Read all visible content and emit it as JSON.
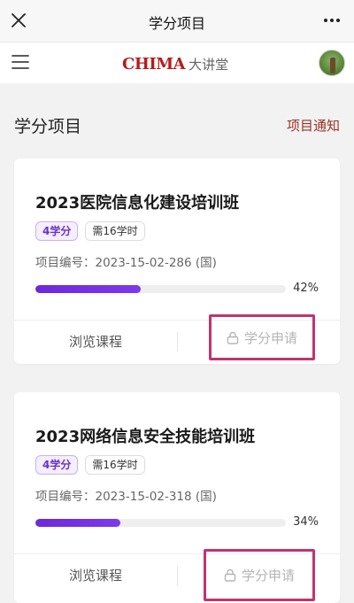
{
  "window": {
    "title": "学分项目"
  },
  "navbar": {
    "logo_brand": "CHIMA",
    "logo_sub": "大讲堂"
  },
  "section": {
    "title": "学分项目",
    "link": "项目通知"
  },
  "projects": [
    {
      "name": "2023医院信息化建设培训班",
      "credit": "4学分",
      "hours": "需16学时",
      "code": "项目编号：2023-15-02-286 (国)",
      "progress": 0.42,
      "progress_label": "42%",
      "browse_label": "浏览课程",
      "apply_label": "学分申请"
    },
    {
      "name": "2023网络信息安全技能培训班",
      "credit": "4学分",
      "hours": "需16学时",
      "code": "项目编号：2023-15-02-318 (国)",
      "progress": 0.34,
      "progress_label": "34%",
      "browse_label": "浏览课程",
      "apply_label": "学分申请"
    }
  ],
  "icons": {
    "close": "close-icon",
    "more": "more-icon",
    "menu": "menu-icon",
    "lock": "lock-icon"
  },
  "colors": {
    "accent_link": "#9b3126",
    "progress": "#6d28d9",
    "highlight_border": "#c2336e",
    "brand_red": "#b71c1c"
  }
}
